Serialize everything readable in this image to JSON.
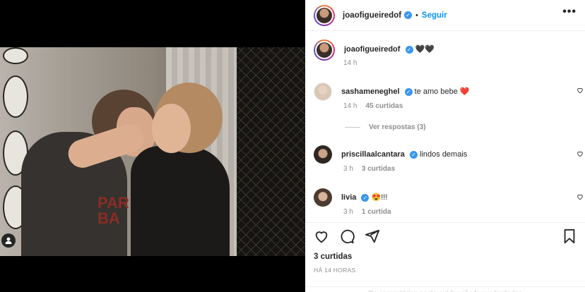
{
  "post": {
    "author": "joaofigueiredof",
    "follow_label": "Seguir",
    "separator": "•",
    "more_label": "•••",
    "caption": "🖤🖤",
    "caption_time": "14 h"
  },
  "photo": {
    "shirt_print": "PAR BA"
  },
  "comments": [
    {
      "user": "sashameneghel",
      "text": "te amo bebe ❤️",
      "time": "14 h",
      "likes": "45 curtidas",
      "view_replies": "Ver respostas (3)"
    },
    {
      "user": "priscillaalcantara",
      "text": "lindos demais",
      "time": "3 h",
      "likes": "3 curtidas"
    },
    {
      "user": "livia",
      "text": "😍!!!",
      "time": "3 h",
      "likes": "1 curtida"
    }
  ],
  "footer": {
    "likes": "3 curtidas",
    "timestamp": "HÁ 14 HORAS",
    "comments_disabled": "Os comentários nesta publicação foram limitados"
  },
  "colors": {
    "link_blue": "#0095f6",
    "verified_blue": "#3897f0",
    "heart_red": "#ed4956",
    "muted_gray": "#8e8e8e"
  }
}
